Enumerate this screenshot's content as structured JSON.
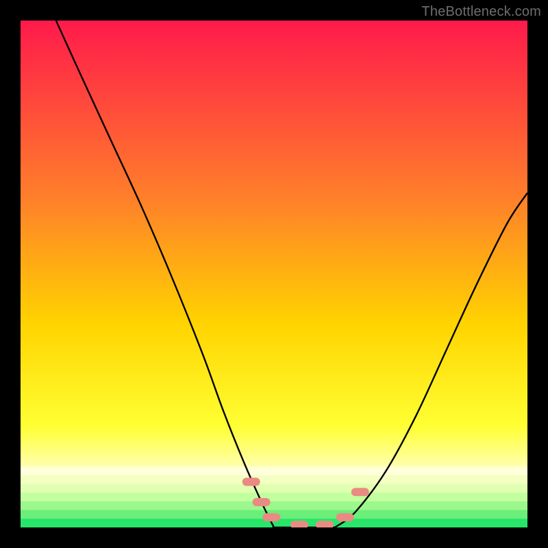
{
  "watermark": "TheBottleneck.com",
  "colors": {
    "top": "#ff1a4b",
    "mid1": "#ff7f2a",
    "mid2": "#ffd400",
    "mid3": "#ffff33",
    "pale": "#ffffcc",
    "green": "#27e66a",
    "curve": "#000000",
    "marker": "#e98b83"
  },
  "chart_data": {
    "type": "line",
    "title": "",
    "xlabel": "",
    "ylabel": "",
    "xlim": [
      0,
      100
    ],
    "ylim": [
      0,
      100
    ],
    "series": [
      {
        "name": "curve-left",
        "x": [
          7,
          12,
          18,
          24,
          30,
          36,
          40,
          44,
          48,
          50
        ],
        "y": [
          100,
          89,
          76,
          63,
          49,
          34,
          23,
          13,
          4,
          0
        ]
      },
      {
        "name": "curve-flat",
        "x": [
          50,
          54,
          58,
          62
        ],
        "y": [
          0,
          0,
          0,
          0
        ]
      },
      {
        "name": "curve-right",
        "x": [
          62,
          66,
          72,
          78,
          84,
          90,
          96,
          100
        ],
        "y": [
          0,
          3,
          11,
          22,
          35,
          48,
          60,
          66
        ]
      }
    ],
    "markers": [
      {
        "x": 45.5,
        "y": 9
      },
      {
        "x": 47.5,
        "y": 5
      },
      {
        "x": 49.5,
        "y": 2
      },
      {
        "x": 55.0,
        "y": 0.5
      },
      {
        "x": 60.0,
        "y": 0.5
      },
      {
        "x": 64.0,
        "y": 2
      },
      {
        "x": 67.0,
        "y": 7
      }
    ],
    "marker_style": "pill",
    "gradient_stops": [
      {
        "offset": 0.0,
        "color_key": "top"
      },
      {
        "offset": 0.35,
        "color_key": "mid1"
      },
      {
        "offset": 0.6,
        "color_key": "mid2"
      },
      {
        "offset": 0.8,
        "color_key": "mid3"
      },
      {
        "offset": 0.9,
        "color_key": "pale"
      },
      {
        "offset": 1.0,
        "color_key": "green"
      }
    ]
  }
}
